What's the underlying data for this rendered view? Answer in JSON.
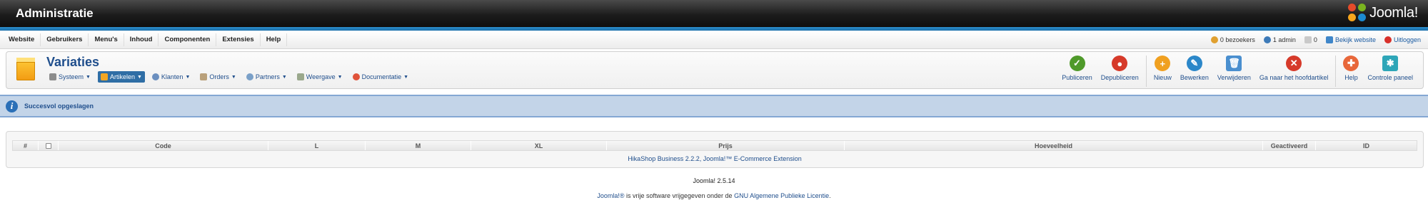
{
  "header": {
    "title": "Administratie",
    "logo_text": "Joomla!"
  },
  "menu": [
    "Website",
    "Gebruikers",
    "Menu's",
    "Inhoud",
    "Componenten",
    "Extensies",
    "Help"
  ],
  "status": {
    "visitors": "0 bezoekers",
    "admins": "1 admin",
    "messages": "0",
    "view_site": "Bekijk website",
    "logout": "Uitloggen"
  },
  "page": {
    "title": "Variaties",
    "submenu": [
      {
        "label": "Systeem",
        "active": false,
        "icon": "wrench-icon"
      },
      {
        "label": "Artikelen",
        "active": true,
        "icon": "box-icon"
      },
      {
        "label": "Klanten",
        "active": false,
        "icon": "users-icon"
      },
      {
        "label": "Orders",
        "active": false,
        "icon": "orders-icon"
      },
      {
        "label": "Partners",
        "active": false,
        "icon": "partners-icon"
      },
      {
        "label": "Weergave",
        "active": false,
        "icon": "display-icon"
      },
      {
        "label": "Documentatie",
        "active": false,
        "icon": "lifebuoy-icon"
      }
    ]
  },
  "toolbar": {
    "publish": "Publiceren",
    "unpublish": "Depubliceren",
    "new": "Nieuw",
    "edit": "Bewerken",
    "delete": "Verwijderen",
    "goto_main": "Ga naar het hoofdartikel",
    "help": "Help",
    "control_panel": "Controle paneel"
  },
  "message": {
    "text": "Succesvol opgeslagen"
  },
  "table": {
    "columns": [
      "#",
      "",
      "Code",
      "L",
      "M",
      "XL",
      "Prijs",
      "Hoeveelheid",
      "Geactiveerd",
      "ID"
    ],
    "footer": "HikaShop Business 2.2.2, Joomla!™ E-Commerce Extension"
  },
  "footer": {
    "version": "Joomla! 2.5.14",
    "joomla_link": "Joomla!®",
    "license_pre": " is vrije software vrijgegeven onder de ",
    "license_link": "GNU Algemene Publieke Licentie",
    "license_post": "."
  },
  "colors": {
    "accent_blue": "#1f4e8c",
    "publish_green": "#4f9a2a",
    "unpublish_red": "#d63a2a",
    "new_orange": "#f0a020",
    "edit_blue": "#2b87c9",
    "message_bg": "#c3d4e8"
  }
}
